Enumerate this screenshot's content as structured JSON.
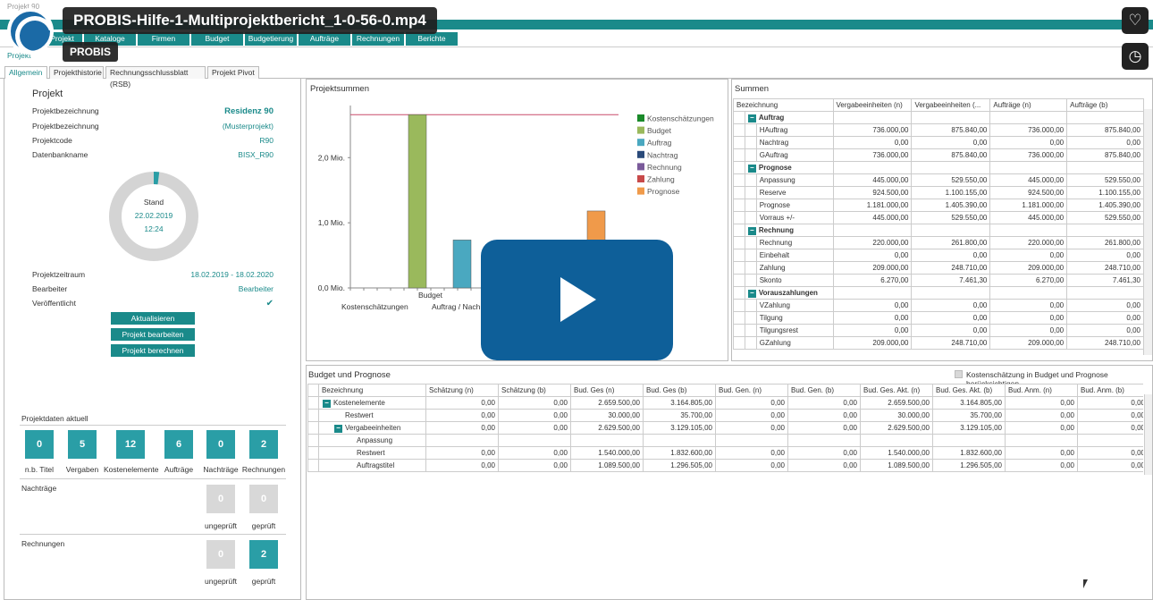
{
  "video": {
    "title": "PROBIS-Hilfe-1-Multiprojektbericht_1-0-56-0.mp4",
    "channel": "PROBIS",
    "window_label": "Projekt 90"
  },
  "menu": [
    "Projekt",
    "Kataloge",
    "Firmen",
    "Budget",
    "Budgetierung",
    "Aufträge",
    "Rechnungen",
    "Berichte"
  ],
  "doc_tab": "Projekt",
  "tabs": [
    "Allgemein",
    "Projekthistorie",
    "Rechnungsschlussblatt (RSB)",
    "Projekt Pivot"
  ],
  "project": {
    "heading": "Projekt",
    "rows": [
      {
        "label": "Projektbezeichnung",
        "value": "Residenz 90"
      },
      {
        "label": "Projektbezeichnung",
        "value": "(Musterprojekt)"
      },
      {
        "label": "Projektcode",
        "value": "R90"
      },
      {
        "label": "Datenbankname",
        "value": "BISX_R90"
      }
    ],
    "donut": {
      "label": "Stand",
      "date": "22.02.2019",
      "time": "12:24",
      "progress": 0.02
    },
    "rows2": [
      {
        "label": "Projektzeitraum",
        "value": "18.02.2019 - 18.02.2020"
      },
      {
        "label": "Bearbeiter",
        "value": "Bearbeiter"
      },
      {
        "label": "Veröffentlicht",
        "value": "✔"
      }
    ],
    "buttons": [
      "Aktualisieren",
      "Projekt bearbeiten",
      "Projekt berechnen"
    ]
  },
  "aktuell": {
    "heading": "Projektdaten aktuell",
    "tiles": [
      {
        "v": "0",
        "l": "n.b. Titel"
      },
      {
        "v": "5",
        "l": "Vergaben"
      },
      {
        "v": "12",
        "l": "Kostenelemente"
      },
      {
        "v": "6",
        "l": "Aufträge"
      },
      {
        "v": "0",
        "l": "Nachträge"
      },
      {
        "v": "2",
        "l": "Rechnungen"
      }
    ],
    "nachtraege_heading": "Nachträge",
    "nachtraege": [
      {
        "v": "0",
        "l": "ungeprüft"
      },
      {
        "v": "0",
        "l": "geprüft"
      }
    ],
    "rechnungen_heading": "Rechnungen",
    "rechnungen": [
      {
        "v": "0",
        "l": "ungeprüft"
      },
      {
        "v": "2",
        "l": "geprüft"
      }
    ]
  },
  "chart_data": {
    "type": "bar",
    "title": "Projektsummen",
    "ylim": [
      0,
      2.8
    ],
    "yticks": [
      {
        "v": 0,
        "l": "0,0 Mio."
      },
      {
        "v": 1,
        "l": "1,0 Mio."
      },
      {
        "v": 2,
        "l": "2,0 Mio."
      }
    ],
    "categories": [
      "Kostenschätzungen",
      "Budget",
      "Auftrag / Nach"
    ],
    "bars": [
      {
        "series": "Budget",
        "value": 2.66,
        "color": "#9ab95c"
      },
      {
        "series": "Auftrag",
        "value": 0.736,
        "color": "#4aa8c0"
      },
      {
        "series": "Prognose",
        "value": 1.181,
        "color": "#f09a4a"
      }
    ],
    "ref_line": 2.66,
    "legend": [
      {
        "name": "Kostenschätzungen",
        "color": "#1a8a2a"
      },
      {
        "name": "Budget",
        "color": "#9ab95c"
      },
      {
        "name": "Auftrag",
        "color": "#4aa8c0"
      },
      {
        "name": "Nachtrag",
        "color": "#2a4a7a"
      },
      {
        "name": "Rechnung",
        "color": "#7a5a9a"
      },
      {
        "name": "Zahlung",
        "color": "#c84a4a"
      },
      {
        "name": "Prognose",
        "color": "#f09a4a"
      }
    ]
  },
  "summen": {
    "title": "Summen",
    "headers": [
      "Bezeichnung",
      "Vergabeeinheiten (n)",
      "Vergabeeinheiten (...",
      "Aufträge (n)",
      "Aufträge (b)"
    ],
    "groups": [
      {
        "name": "Auftrag",
        "rows": [
          [
            "HAuftrag",
            "736.000,00",
            "875.840,00",
            "736.000,00",
            "875.840,00"
          ],
          [
            "Nachtrag",
            "0,00",
            "0,00",
            "0,00",
            "0,00"
          ],
          [
            "GAuftrag",
            "736.000,00",
            "875.840,00",
            "736.000,00",
            "875.840,00"
          ]
        ]
      },
      {
        "name": "Prognose",
        "rows": [
          [
            "Anpassung",
            "445.000,00",
            "529.550,00",
            "445.000,00",
            "529.550,00"
          ],
          [
            "Reserve",
            "924.500,00",
            "1.100.155,00",
            "924.500,00",
            "1.100.155,00"
          ],
          [
            "Prognose",
            "1.181.000,00",
            "1.405.390,00",
            "1.181.000,00",
            "1.405.390,00"
          ],
          [
            "Vorraus +/-",
            "445.000,00",
            "529.550,00",
            "445.000,00",
            "529.550,00"
          ]
        ]
      },
      {
        "name": "Rechnung",
        "rows": [
          [
            "Rechnung",
            "220.000,00",
            "261.800,00",
            "220.000,00",
            "261.800,00"
          ],
          [
            "Einbehalt",
            "0,00",
            "0,00",
            "0,00",
            "0,00"
          ],
          [
            "Zahlung",
            "209.000,00",
            "248.710,00",
            "209.000,00",
            "248.710,00"
          ],
          [
            "Skonto",
            "6.270,00",
            "7.461,30",
            "6.270,00",
            "7.461,30"
          ]
        ]
      },
      {
        "name": "Vorauszahlungen",
        "rows": [
          [
            "VZahlung",
            "0,00",
            "0,00",
            "0,00",
            "0,00"
          ],
          [
            "Tilgung",
            "0,00",
            "0,00",
            "0,00",
            "0,00"
          ],
          [
            "Tilgungsrest",
            "0,00",
            "0,00",
            "0,00",
            "0,00"
          ],
          [
            "GZahlung",
            "209.000,00",
            "248.710,00",
            "209.000,00",
            "248.710,00"
          ]
        ]
      }
    ]
  },
  "budget": {
    "title": "Budget und Prognose",
    "checkbox_label": "Kostenschätzung in Budget und Prognose berücksichtigen",
    "headers": [
      "Bezeichnung",
      "Schätzung (n)",
      "Schätzung (b)",
      "Bud. Ges (n)",
      "Bud. Ges (b)",
      "Bud. Gen. (n)",
      "Bud. Gen. (b)",
      "Bud. Ges. Akt. (n)",
      "Bud. Ges. Akt. (b)",
      "Bud. Anm. (n)",
      "Bud. Anm. (b)"
    ],
    "rows": [
      {
        "indent": 0,
        "toggle": true,
        "cells": [
          "Kostenelemente",
          "0,00",
          "0,00",
          "2.659.500,00",
          "3.164.805,00",
          "0,00",
          "0,00",
          "2.659.500,00",
          "3.164.805,00",
          "0,00",
          "0,00"
        ]
      },
      {
        "indent": 1,
        "toggle": false,
        "cells": [
          "Restwert",
          "0,00",
          "0,00",
          "30.000,00",
          "35.700,00",
          "0,00",
          "0,00",
          "30.000,00",
          "35.700,00",
          "0,00",
          "0,00"
        ]
      },
      {
        "indent": 1,
        "toggle": true,
        "cells": [
          "Vergabeeinheiten",
          "0,00",
          "0,00",
          "2.629.500,00",
          "3.129.105,00",
          "0,00",
          "0,00",
          "2.629.500,00",
          "3.129.105,00",
          "0,00",
          "0,00"
        ]
      },
      {
        "indent": 2,
        "toggle": false,
        "cells": [
          "Anpassung",
          "",
          "",
          "",
          "",
          "",
          "",
          "",
          "",
          "",
          ""
        ]
      },
      {
        "indent": 2,
        "toggle": false,
        "cells": [
          "Restwert",
          "0,00",
          "0,00",
          "1.540.000,00",
          "1.832.600,00",
          "0,00",
          "0,00",
          "1.540.000,00",
          "1.832.600,00",
          "0,00",
          "0,00"
        ]
      },
      {
        "indent": 2,
        "toggle": false,
        "cells": [
          "Auftragstitel",
          "0,00",
          "0,00",
          "1.089.500,00",
          "1.296.505,00",
          "0,00",
          "0,00",
          "1.089.500,00",
          "1.296.505,00",
          "0,00",
          "0,00"
        ]
      }
    ]
  }
}
